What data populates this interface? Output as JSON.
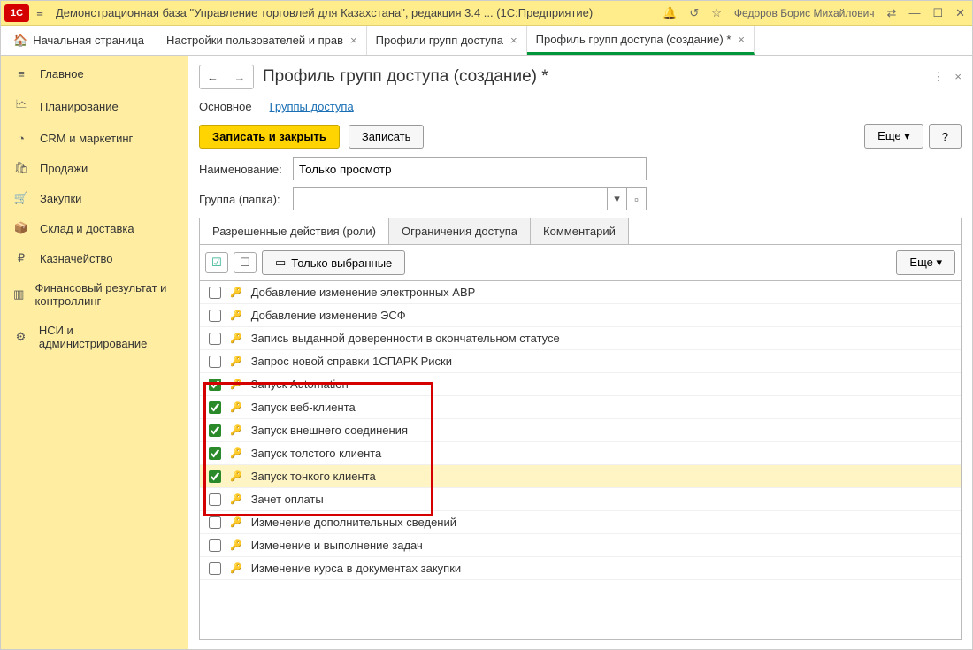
{
  "titlebar": {
    "logo": "1C",
    "title": "Демонстрационная база \"Управление торговлей для Казахстана\", редакция 3.4 ...  (1С:Предприятие)",
    "user": "Федоров Борис Михайлович"
  },
  "tabs": {
    "home": "Начальная страница",
    "items": [
      {
        "label": "Настройки пользователей и прав"
      },
      {
        "label": "Профили групп доступа"
      },
      {
        "label": "Профиль групп доступа (создание) *",
        "active": true
      }
    ]
  },
  "sidebar": {
    "items": [
      {
        "icon": "≡",
        "label": "Главное"
      },
      {
        "icon": "📊",
        "label": "Планирование"
      },
      {
        "icon": "◔",
        "label": "CRM и маркетинг"
      },
      {
        "icon": "🛍",
        "label": "Продажи"
      },
      {
        "icon": "🛒",
        "label": "Закупки"
      },
      {
        "icon": "📦",
        "label": "Склад и доставка"
      },
      {
        "icon": "₽",
        "label": "Казначейство"
      },
      {
        "icon": "📈",
        "label": "Финансовый результат и контроллинг"
      },
      {
        "icon": "⚙",
        "label": "НСИ и администрирование"
      }
    ]
  },
  "page": {
    "title": "Профиль групп доступа (создание) *",
    "links": {
      "main": "Основное",
      "groups": "Группы доступа"
    },
    "buttons": {
      "save_close": "Записать и закрыть",
      "save": "Записать",
      "more": "Еще",
      "help": "?"
    },
    "form": {
      "name_label": "Наименование:",
      "name_value": "Только просмотр",
      "group_label": "Группа (папка):",
      "group_value": ""
    },
    "inner_tabs": {
      "roles": "Разрешенные действия (роли)",
      "restrictions": "Ограничения доступа",
      "comment": "Комментарий"
    },
    "toolbar": {
      "only_selected": "Только выбранные",
      "more": "Еще"
    },
    "roles": [
      {
        "checked": false,
        "label": "Добавление изменение электронных АВР"
      },
      {
        "checked": false,
        "label": "Добавление изменение ЭСФ"
      },
      {
        "checked": false,
        "label": "Запись выданной доверенности в окончательном статусе"
      },
      {
        "checked": false,
        "label": "Запрос новой справки 1СПАРК Риски"
      },
      {
        "checked": true,
        "label": "Запуск Automation"
      },
      {
        "checked": true,
        "label": "Запуск веб-клиента"
      },
      {
        "checked": true,
        "label": "Запуск внешнего соединения"
      },
      {
        "checked": true,
        "label": "Запуск толстого клиента"
      },
      {
        "checked": true,
        "label": "Запуск тонкого клиента",
        "selected": true
      },
      {
        "checked": false,
        "label": "Зачет оплаты"
      },
      {
        "checked": false,
        "label": "Изменение дополнительных сведений"
      },
      {
        "checked": false,
        "label": "Изменение и выполнение задач"
      },
      {
        "checked": false,
        "label": "Изменение курса в документах закупки"
      }
    ]
  }
}
